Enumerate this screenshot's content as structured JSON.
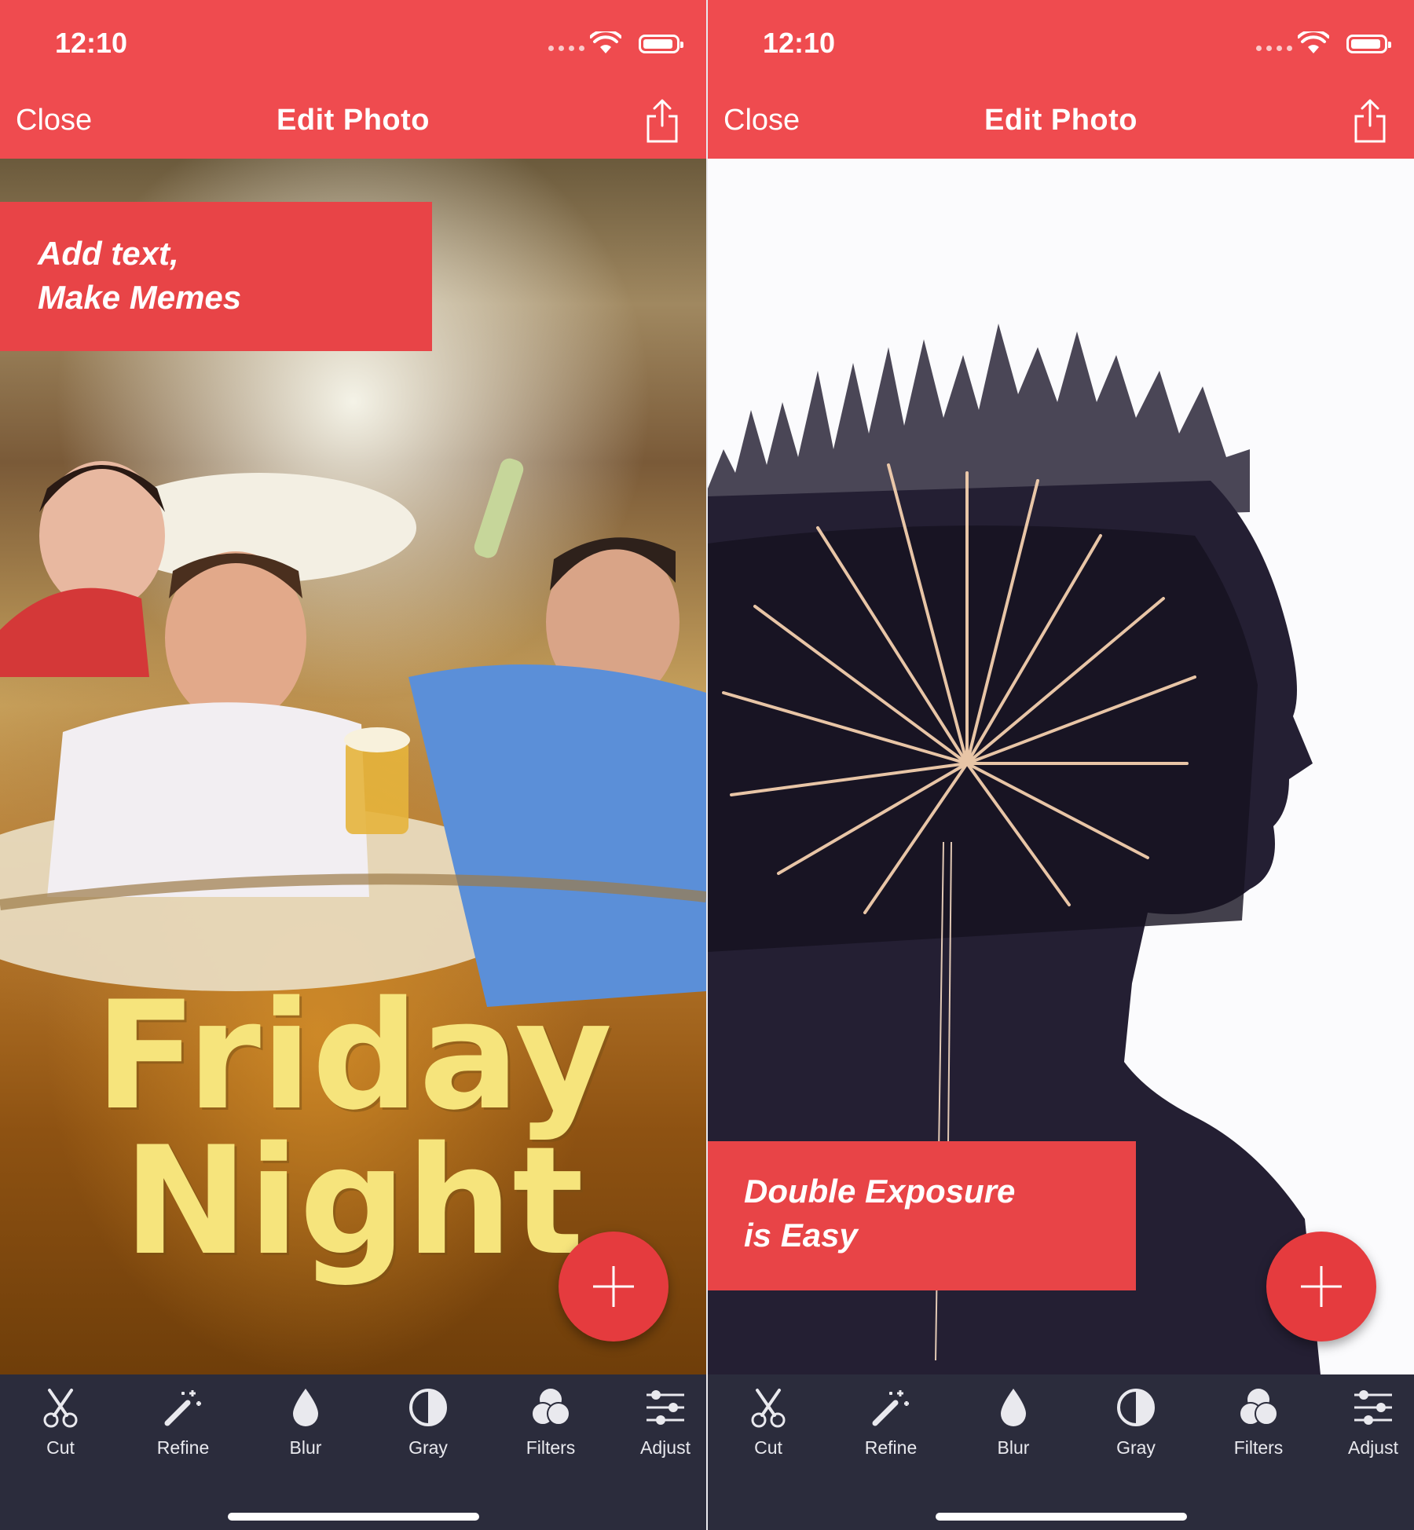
{
  "screens": [
    {
      "status": {
        "time": "12:10"
      },
      "nav": {
        "close": "Close",
        "title": "Edit Photo",
        "share_icon": "share-icon"
      },
      "banner": {
        "line1": "Add text,",
        "line2": "Make Memes"
      },
      "meme_text": {
        "line1": "Friday",
        "line2": "Night"
      },
      "fab_icon": "plus-icon",
      "tabs": [
        {
          "label": "Cut",
          "icon": "scissors-icon"
        },
        {
          "label": "Refine",
          "icon": "magic-wand-icon"
        },
        {
          "label": "Blur",
          "icon": "drop-icon"
        },
        {
          "label": "Gray",
          "icon": "half-circle-icon"
        },
        {
          "label": "Filters",
          "icon": "filters-icon"
        },
        {
          "label": "Adjust",
          "icon": "sliders-icon"
        }
      ]
    },
    {
      "status": {
        "time": "12:10"
      },
      "nav": {
        "close": "Close",
        "title": "Edit Photo",
        "share_icon": "share-icon"
      },
      "banner": {
        "line1": "Double Exposure",
        "line2": "is Easy"
      },
      "fab_icon": "plus-icon",
      "tabs": [
        {
          "label": "Cut",
          "icon": "scissors-icon"
        },
        {
          "label": "Refine",
          "icon": "magic-wand-icon"
        },
        {
          "label": "Blur",
          "icon": "drop-icon"
        },
        {
          "label": "Gray",
          "icon": "half-circle-icon"
        },
        {
          "label": "Filters",
          "icon": "filters-icon"
        },
        {
          "label": "Adjust",
          "icon": "sliders-icon"
        }
      ]
    }
  ],
  "colors": {
    "accent": "#ef4b4f",
    "fab": "#e53b3e",
    "tabbar": "#2b2c3c",
    "meme_text": "#f6e47c"
  }
}
